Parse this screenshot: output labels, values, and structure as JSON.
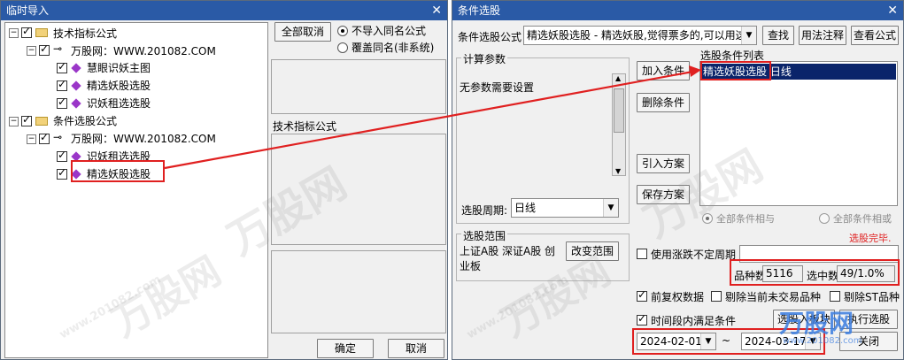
{
  "left_window": {
    "title": "临时导入",
    "close_glyph": "✕",
    "tree": {
      "root1": "技术指标公式",
      "root1_child": "万股网：WWW.201082.COM",
      "root1_items": [
        "慧眼识妖主图",
        "精选妖股选股",
        "识妖租选选股"
      ],
      "root2": "条件选股公式",
      "root2_child": "万股网：WWW.201082.COM",
      "root2_items": [
        "识妖租选选股",
        "精选妖股选股"
      ]
    },
    "cancel_all_button": "全部取消",
    "radio_no_import": "不导入同名公式",
    "radio_overwrite": "覆盖同名(非系统)",
    "section_label": "技术指标公式",
    "ok_button": "确定",
    "cancel_button": "取消"
  },
  "right_window": {
    "title": "条件选股",
    "close_glyph": "✕",
    "formula_label": "条件选股公式",
    "formula_value": "精选妖股选股  - 精选妖股,觉得票多的,可以用这个",
    "find_button": "查找",
    "usage_button": "用法注释",
    "view_button": "查看公式",
    "calc_params_label": "计算参数",
    "no_params_text": "无参数需要设置",
    "add_condition_button": "加入条件",
    "delete_condition_button": "删除条件",
    "import_plan_button": "引入方案",
    "save_plan_button": "保存方案",
    "condition_list_label": "选股条件列表",
    "condition_list": [
      "精选妖股选股  日线"
    ],
    "radio_all_and": "全部条件相与",
    "radio_all_or": "全部条件相或",
    "period_label": "选股周期:",
    "period_value": "日线",
    "range_label": "选股范围",
    "range_value": "上证A股 深证A股 创业板",
    "change_range_button": "改变范围",
    "done_status": "选股完毕.",
    "use_float_period": "使用涨跌不定周期",
    "stock_count_label": "品种数",
    "stock_count_value": "5116",
    "selected_label": "选中数",
    "selected_value": "49/1.0%",
    "pre_adjust": "前复权数据",
    "exclude_untraded": "剔除当前未交易品种",
    "exclude_st": "剔除ST品种",
    "period_satisfy": "时间段内满足条件",
    "select_into_block_button": "选股入板块",
    "execute_button": "执行选股",
    "start_date": "2024-02-01",
    "end_date": "2024-03-17",
    "close_button": "关闭"
  },
  "watermark": {
    "brand": "万股网",
    "url": "www.201082.com"
  },
  "colors": {
    "title_bar": "#2a5aa6",
    "selection": "#0a246a",
    "highlight_red": "#e02020",
    "status_red": "#e02020"
  }
}
